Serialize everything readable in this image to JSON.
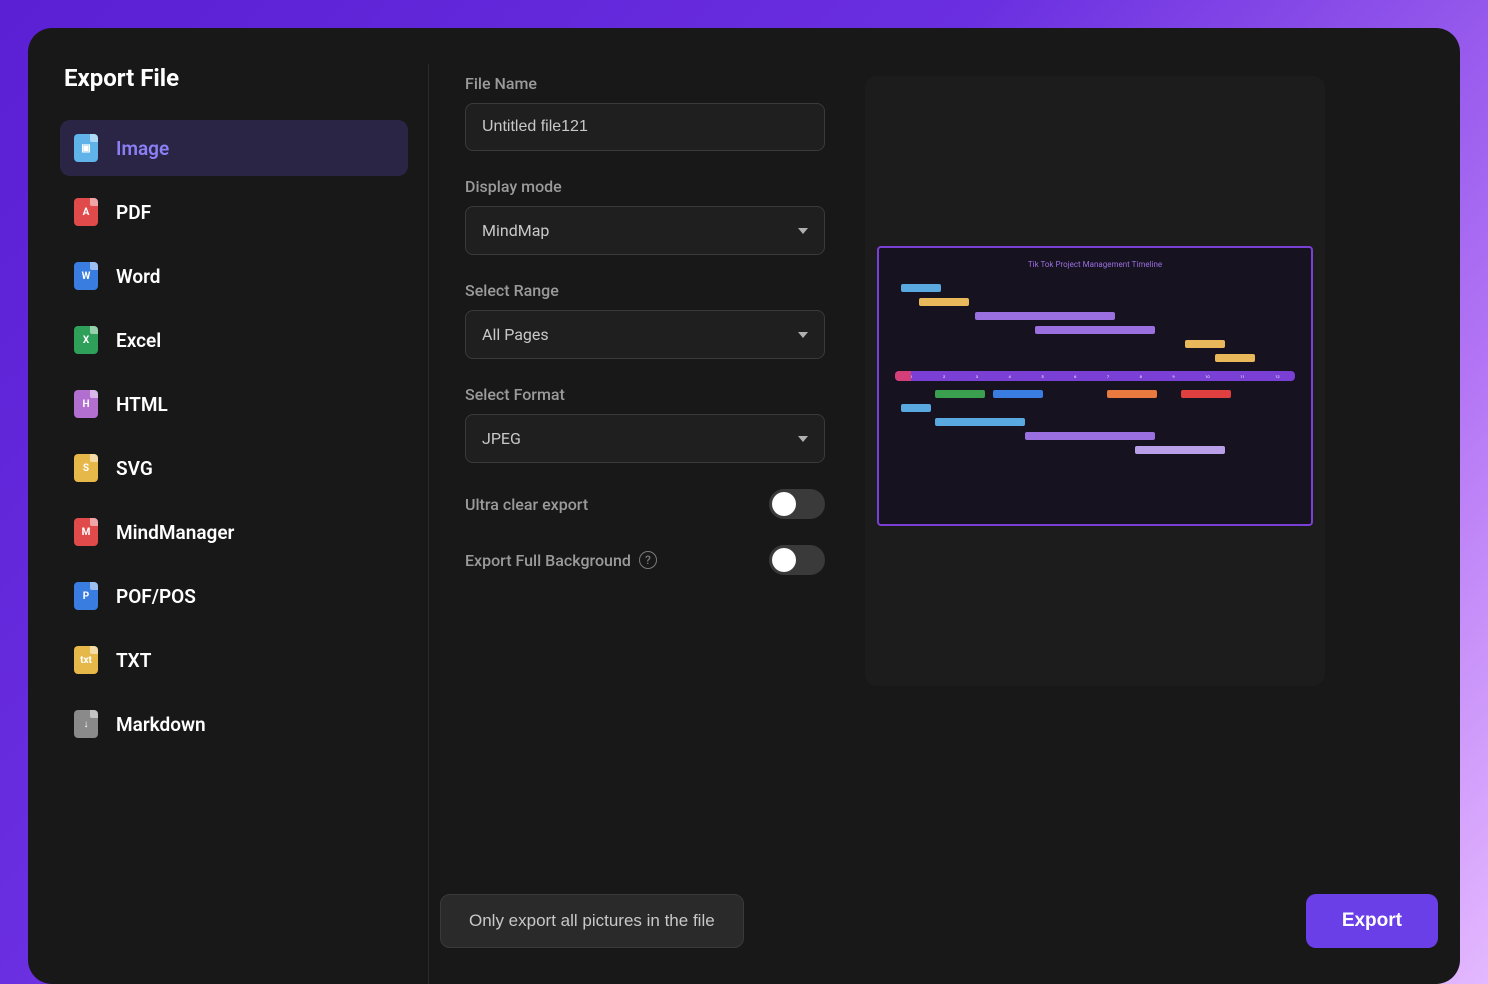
{
  "header": {
    "title": "Export File"
  },
  "sidebar": {
    "items": [
      {
        "label": "Image",
        "icon": "image",
        "active": true
      },
      {
        "label": "PDF",
        "icon": "pdf",
        "active": false
      },
      {
        "label": "Word",
        "icon": "word",
        "active": false
      },
      {
        "label": "Excel",
        "icon": "excel",
        "active": false
      },
      {
        "label": "HTML",
        "icon": "html",
        "active": false
      },
      {
        "label": "SVG",
        "icon": "svg",
        "active": false
      },
      {
        "label": "MindManager",
        "icon": "mm",
        "active": false
      },
      {
        "label": "POF/POS",
        "icon": "pos",
        "active": false
      },
      {
        "label": "TXT",
        "icon": "txt",
        "active": false
      },
      {
        "label": "Markdown",
        "icon": "md",
        "active": false
      }
    ]
  },
  "form": {
    "filename_label": "File Name",
    "filename_value": "Untitled file121",
    "display_mode_label": "Display mode",
    "display_mode_value": "MindMap",
    "select_range_label": "Select Range",
    "select_range_value": "All Pages",
    "select_format_label": "Select Format",
    "select_format_value": "JPEG",
    "ultra_clear_label": "Ultra clear export",
    "ultra_clear_value": false,
    "full_bg_label": "Export Full Background",
    "full_bg_value": false
  },
  "preview": {
    "title": "Tik Tok Project Management Timeline"
  },
  "footer": {
    "secondary_button": "Only export all pictures in the file",
    "primary_button": "Export"
  },
  "colors": {
    "accent": "#6a3fe8",
    "background": "#181818",
    "surface": "#1f1f1f",
    "border": "#3a3a3a",
    "text_muted": "#9a9a9a"
  }
}
